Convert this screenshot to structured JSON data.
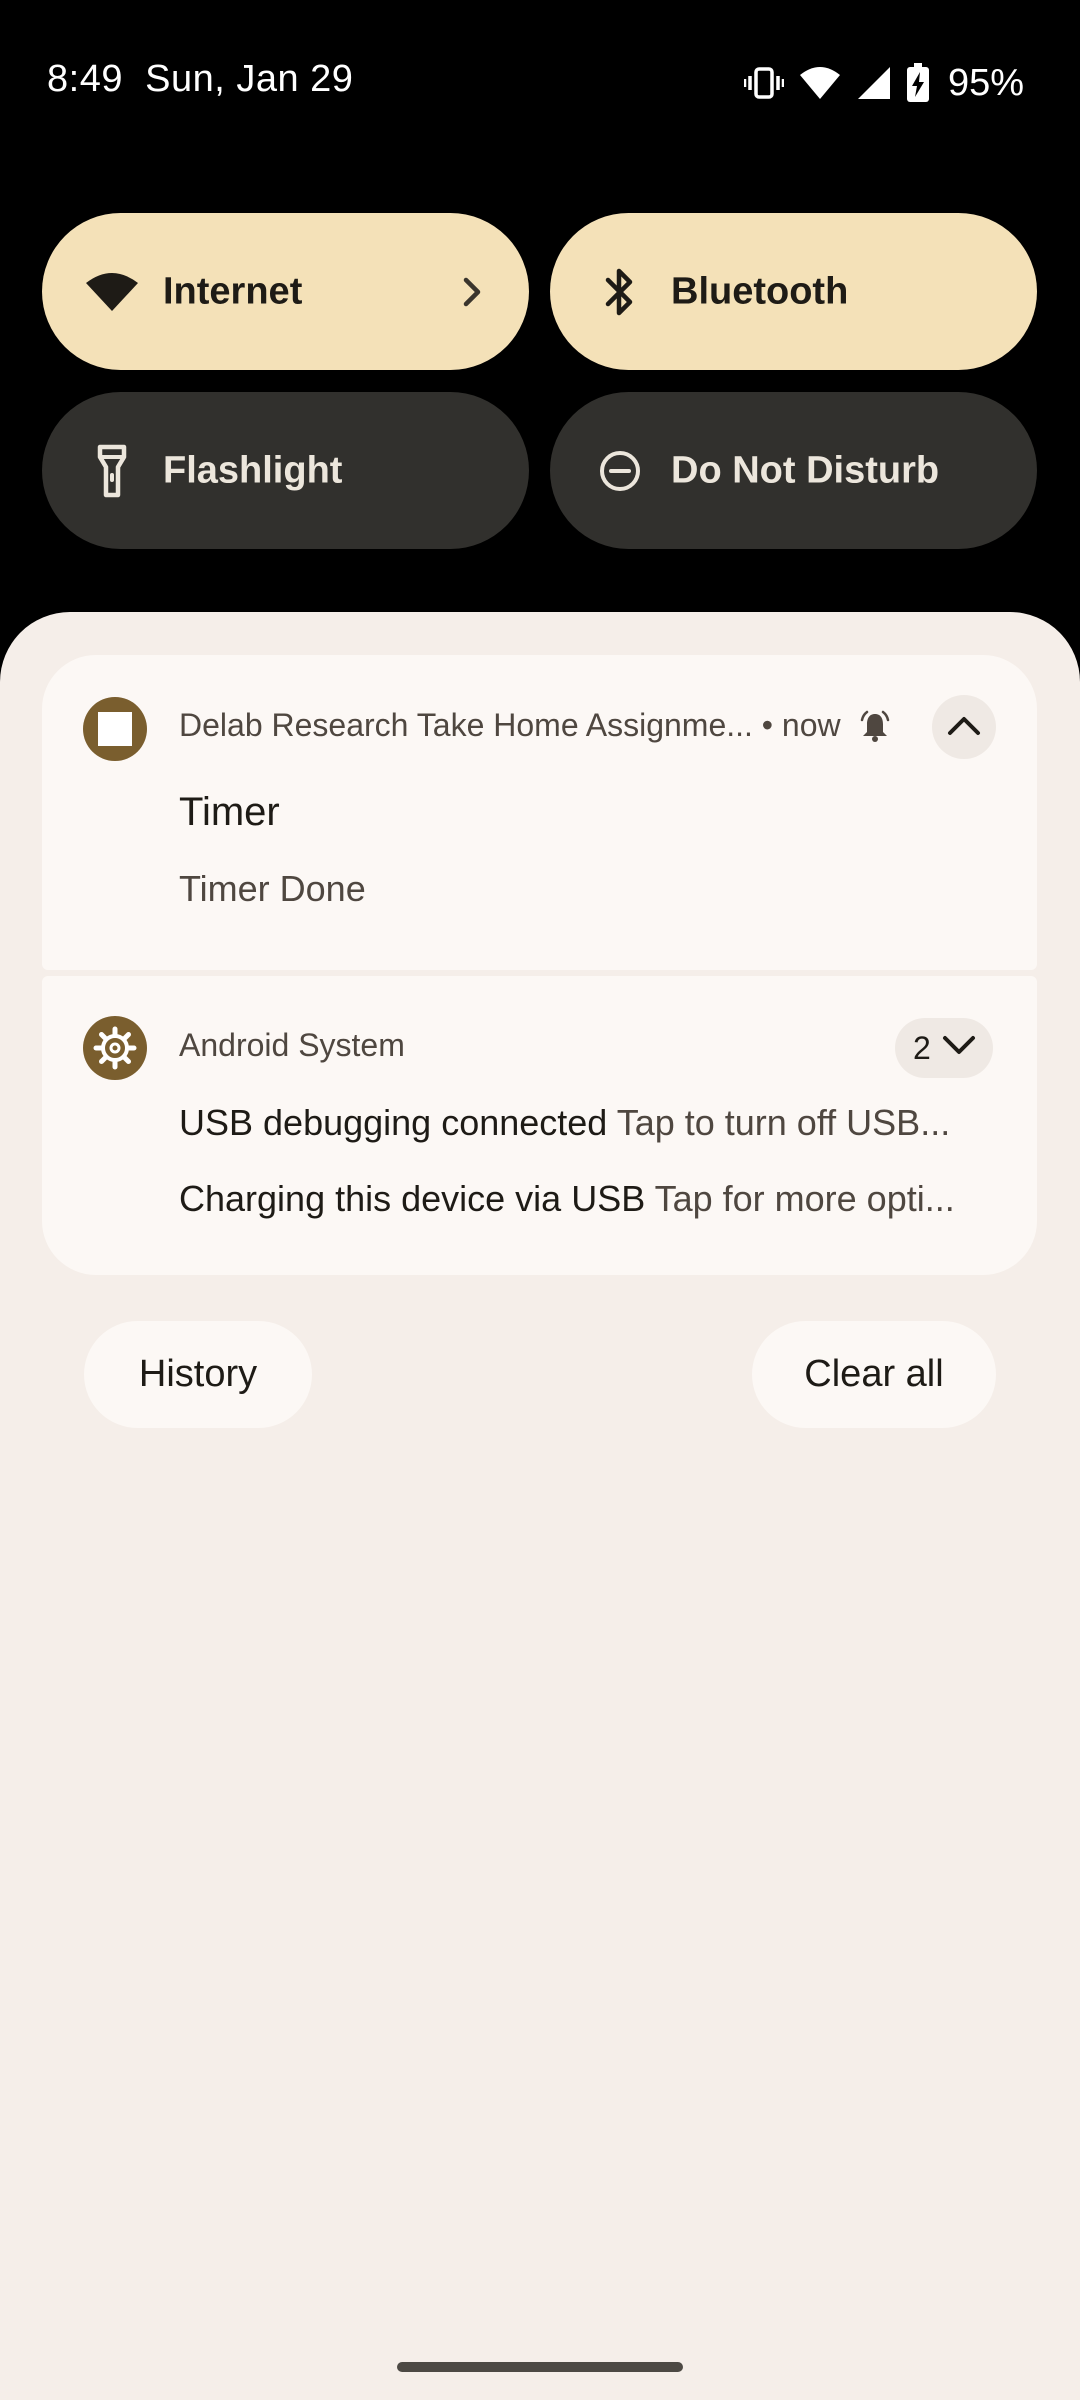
{
  "status_bar": {
    "time": "8:49",
    "date": "Sun, Jan 29",
    "battery_percent": "95%",
    "icons": [
      "vibrate-icon",
      "wifi-icon",
      "cell-signal-icon",
      "battery-charging-icon"
    ]
  },
  "quick_settings": {
    "tiles": [
      {
        "label": "Internet",
        "icon": "wifi-icon",
        "state": "on",
        "has_chevron": true
      },
      {
        "label": "Bluetooth",
        "icon": "bluetooth-icon",
        "state": "on"
      },
      {
        "label": "Flashlight",
        "icon": "flashlight-icon",
        "state": "off"
      },
      {
        "label": "Do Not Disturb",
        "icon": "do-not-disturb-icon",
        "state": "off"
      }
    ],
    "colors": {
      "on": "#f4e1b8",
      "off": "#31302d"
    }
  },
  "notifications": [
    {
      "app_name": "Delab Research Take Home Assignme...",
      "separator": "•",
      "time": "now",
      "alert_icon": "bell-alert-icon",
      "title": "Timer",
      "text": "Timer Done",
      "expanded": true
    },
    {
      "app_name": "Android System",
      "count": "2",
      "expanded": false,
      "lines": [
        {
          "bold": "USB debugging connected",
          "text": "Tap to turn off USB..."
        },
        {
          "bold": "Charging this device via USB",
          "text": "Tap for more opti..."
        }
      ]
    }
  ],
  "actions": {
    "history": "History",
    "clear_all": "Clear all"
  },
  "theme": {
    "shade_bg": "#f5eee9",
    "card_bg": "#fcf8f5",
    "accent": "#7a5e2e"
  }
}
